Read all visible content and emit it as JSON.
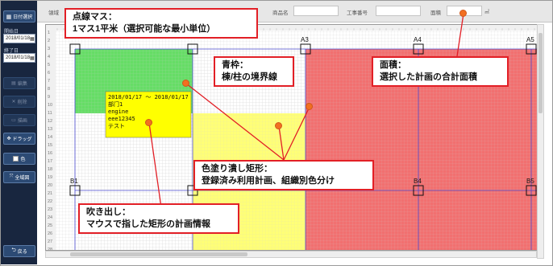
{
  "sidebar": {
    "date_select_button": "日付選択",
    "start_label": "開始日",
    "start_date": "2018/01/18",
    "end_label": "終了日",
    "end_date": "2018/01/18",
    "edit_button": "編集",
    "delete_button": "削除",
    "draw_button": "描画",
    "drag_button": "ドラッグ",
    "color_button": "色",
    "fullscreen_button": "全域図",
    "back_button": "戻る"
  },
  "header": {
    "area_label": "領域",
    "product_label": "商品名",
    "work_number_label": "工事番号",
    "area_size_label": "面積",
    "area_size_value": "",
    "area_unit": "㎡"
  },
  "grid": {
    "column_labels": [
      "A3",
      "A4",
      "A5"
    ],
    "row_labels": [
      "B1",
      "B4",
      "B5"
    ],
    "row_numbers": [
      "1",
      "2",
      "3",
      "4",
      "5",
      "6",
      "7",
      "8",
      "9",
      "10",
      "11",
      "12",
      "13",
      "14",
      "15",
      "16",
      "17",
      "18",
      "19",
      "20",
      "21",
      "22",
      "23",
      "24",
      "25",
      "26",
      "27",
      "28"
    ],
    "colors": {
      "green": "#66dd66",
      "yellow": "#ffff77",
      "red": "#f27070",
      "boundary": "#4a4acf",
      "grid": "#c8c8c8"
    }
  },
  "tooltip": {
    "lines": [
      "2018/01/17 ～ 2018/01/17",
      "部门1",
      "engine",
      "eee12345",
      "テスト"
    ],
    "background": "#ffff00"
  },
  "callouts": {
    "dotted_grid": {
      "line1": "点線マス：",
      "line2": "1マス1平米（選択可能な最小単位）"
    },
    "blue_frame": {
      "line1": "青枠：",
      "line2": "棟/柱の境界線"
    },
    "area": {
      "line1": "面積：",
      "line2": "選択した計画の合計面積"
    },
    "filled_rect": {
      "line1": "色塗り潰し矩形：",
      "line2": "登録済み利用計画、組織別色分け"
    },
    "balloon": {
      "line1": "吹き出し：",
      "line2": "マウスで指した矩形の計画情報"
    },
    "border_color": "#e21f26",
    "anchor_color": "#f26f21"
  }
}
